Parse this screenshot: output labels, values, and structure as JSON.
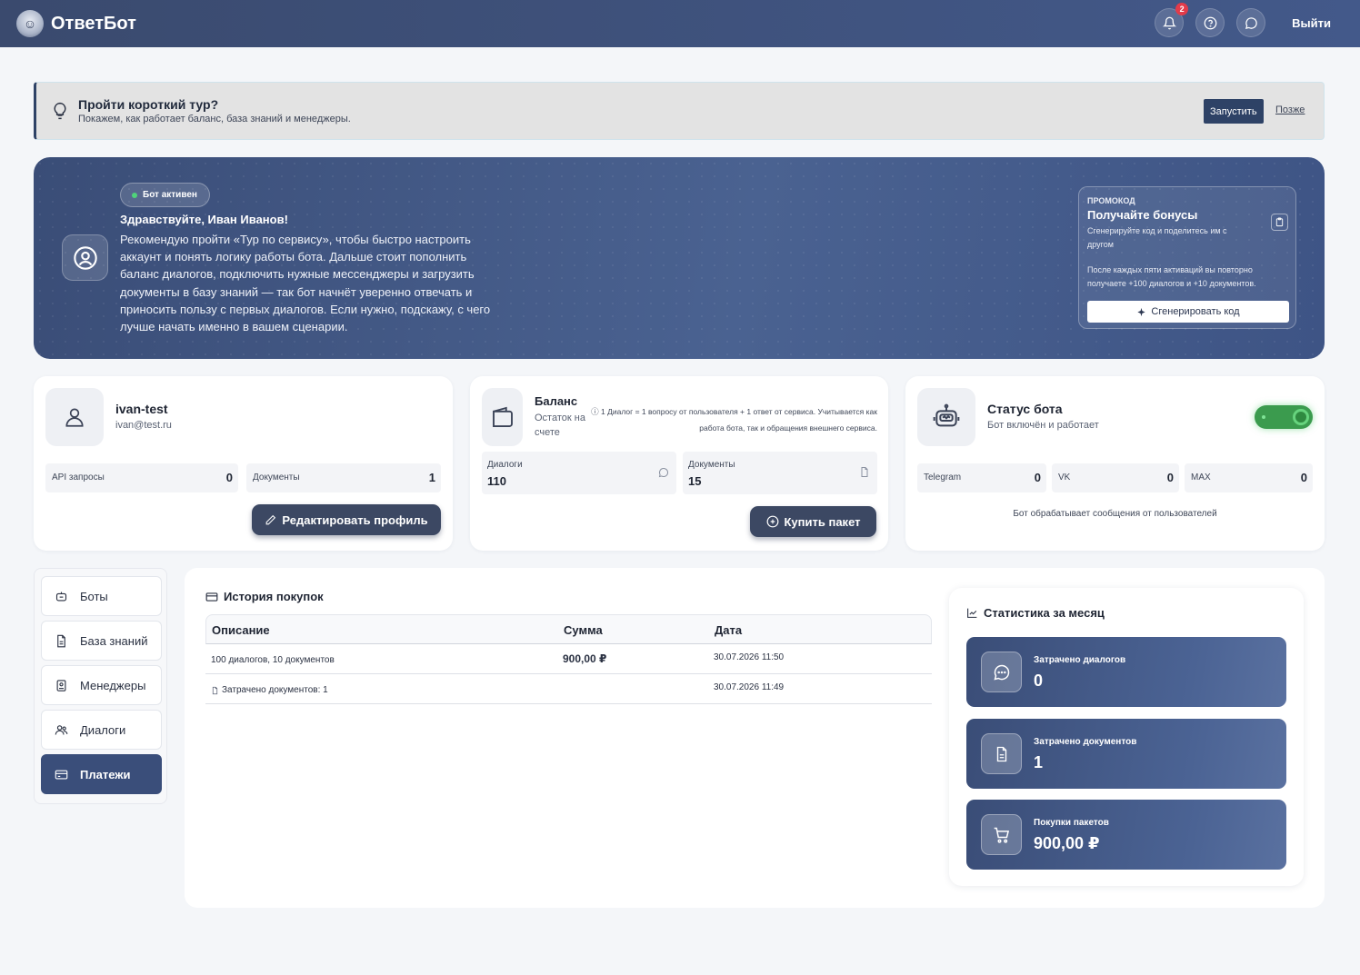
{
  "header": {
    "brand": "ОтветБот",
    "notifications_count": "2",
    "logout_label": "Выйти"
  },
  "tour": {
    "title": "Пройти короткий тур?",
    "subtitle": "Покажем, как работает баланс, база знаний и менеджеры.",
    "start_label": "Запустить",
    "later_label": "Позже"
  },
  "hero": {
    "status_pill": "Бот активен",
    "greeting": "Здравствуйте, Иван Иванов!",
    "text": "Рекомендую пройти «Тур по сервису», чтобы быстро настроить аккаунт и понять логику работы бота. Дальше стоит пополнить баланс диалогов, подключить нужные мессенджеры и загрузить документы в базу знаний — так бот начнёт уверенно отвечать и приносить пользу с первых диалогов. Если нужно, подскажу, с чего лучше начать именно в вашем сценарии."
  },
  "promo": {
    "label": "ПРОМОКОД",
    "title": "Получайте бонусы",
    "subtitle": "Сгенерируйте код и поделитесь им с другом",
    "note": "После каждых пяти активаций вы повторно получаете +100 диалогов и +10 документов.",
    "button_label": "Сгенерировать код"
  },
  "profile": {
    "username": "ivan-test",
    "email": "ivan@test.ru",
    "stats": [
      {
        "label": "API запросы",
        "value": "0"
      },
      {
        "label": "Документы",
        "value": "1"
      }
    ],
    "edit_label": "Редактировать профиль"
  },
  "balance": {
    "title": "Баланс",
    "subtitle": "Остаток на счете",
    "hint": "ⓘ 1 Диалог = 1 вопросу от пользователя + 1 ответ от сервиса. Учитывается как работа бота, так и обращения внешнего сервиса.",
    "dialogs_label": "Диалоги",
    "dialogs_value": "110",
    "documents_label": "Документы",
    "documents_value": "15",
    "buy_label": "Купить пакет"
  },
  "bot_status": {
    "title": "Статус бота",
    "subtitle": "Бот включён и работает",
    "enabled": true,
    "channels": [
      {
        "label": "Telegram",
        "value": "0"
      },
      {
        "label": "VK",
        "value": "0"
      },
      {
        "label": "MAX",
        "value": "0"
      }
    ],
    "footer": "Бот обрабатывает сообщения от пользователей"
  },
  "sidebar": {
    "items": [
      {
        "label": "Боты",
        "icon": "robot-icon"
      },
      {
        "label": "База знаний",
        "icon": "document-icon"
      },
      {
        "label": "Менеджеры",
        "icon": "badge-icon"
      },
      {
        "label": "Диалоги",
        "icon": "users-icon"
      },
      {
        "label": "Платежи",
        "icon": "credit-card-icon",
        "active": true
      }
    ]
  },
  "purchases": {
    "title": "История покупок",
    "columns": [
      "Описание",
      "Сумма",
      "Дата"
    ],
    "rows": [
      {
        "description": "100 диалогов, 10 документов",
        "amount": "900,00 ₽",
        "date": "30.07.2026 11:50"
      },
      {
        "description": "Затрачено документов: 1",
        "amount": "",
        "date": "30.07.2026 11:49"
      }
    ]
  },
  "monthly_stats": {
    "title": "Статистика за месяц",
    "cards": [
      {
        "label": "Затрачено диалогов",
        "value": "0",
        "icon": "chat-icon"
      },
      {
        "label": "Затрачено документов",
        "value": "1",
        "icon": "document-icon"
      },
      {
        "label": "Покупки пакетов",
        "value": "900,00 ₽",
        "icon": "cart-icon"
      }
    ]
  },
  "colors": {
    "header": "#3a4a6e",
    "accent": "#3a4e7a",
    "button_dark": "#3c4863",
    "toggle_on": "#3b9b4e",
    "badge": "#e23b4a"
  }
}
